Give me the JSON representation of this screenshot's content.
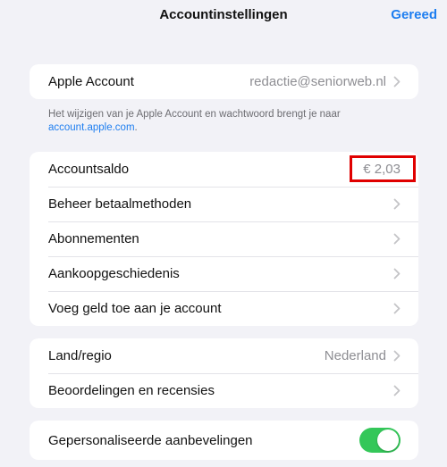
{
  "header": {
    "title": "Accountinstellingen",
    "done_label": "Gereed"
  },
  "apple_account": {
    "label": "Apple Account",
    "value": "redactie@seniorweb.nl",
    "footer_text": "Het wijzigen van je Apple Account en wachtwoord brengt je naar",
    "footer_link": "account.apple.com",
    "footer_period": "."
  },
  "account_group": {
    "items": [
      {
        "label": "Accountsaldo",
        "value": "€ 2,03"
      },
      {
        "label": "Beheer betaalmethoden"
      },
      {
        "label": "Abonnementen"
      },
      {
        "label": "Aankoopgeschiedenis"
      },
      {
        "label": "Voeg geld toe aan je account"
      }
    ]
  },
  "region_group": {
    "items": [
      {
        "label": "Land/regio",
        "value": "Nederland"
      },
      {
        "label": "Beoordelingen en recensies"
      }
    ]
  },
  "personalization": {
    "label": "Gepersonaliseerde aanbevelingen",
    "toggle_on": true
  },
  "colors": {
    "accent": "#1e7ef0",
    "toggle_on": "#34c759",
    "highlight": "#e00000"
  },
  "icons": {
    "chevron": "chevron-right-icon"
  }
}
